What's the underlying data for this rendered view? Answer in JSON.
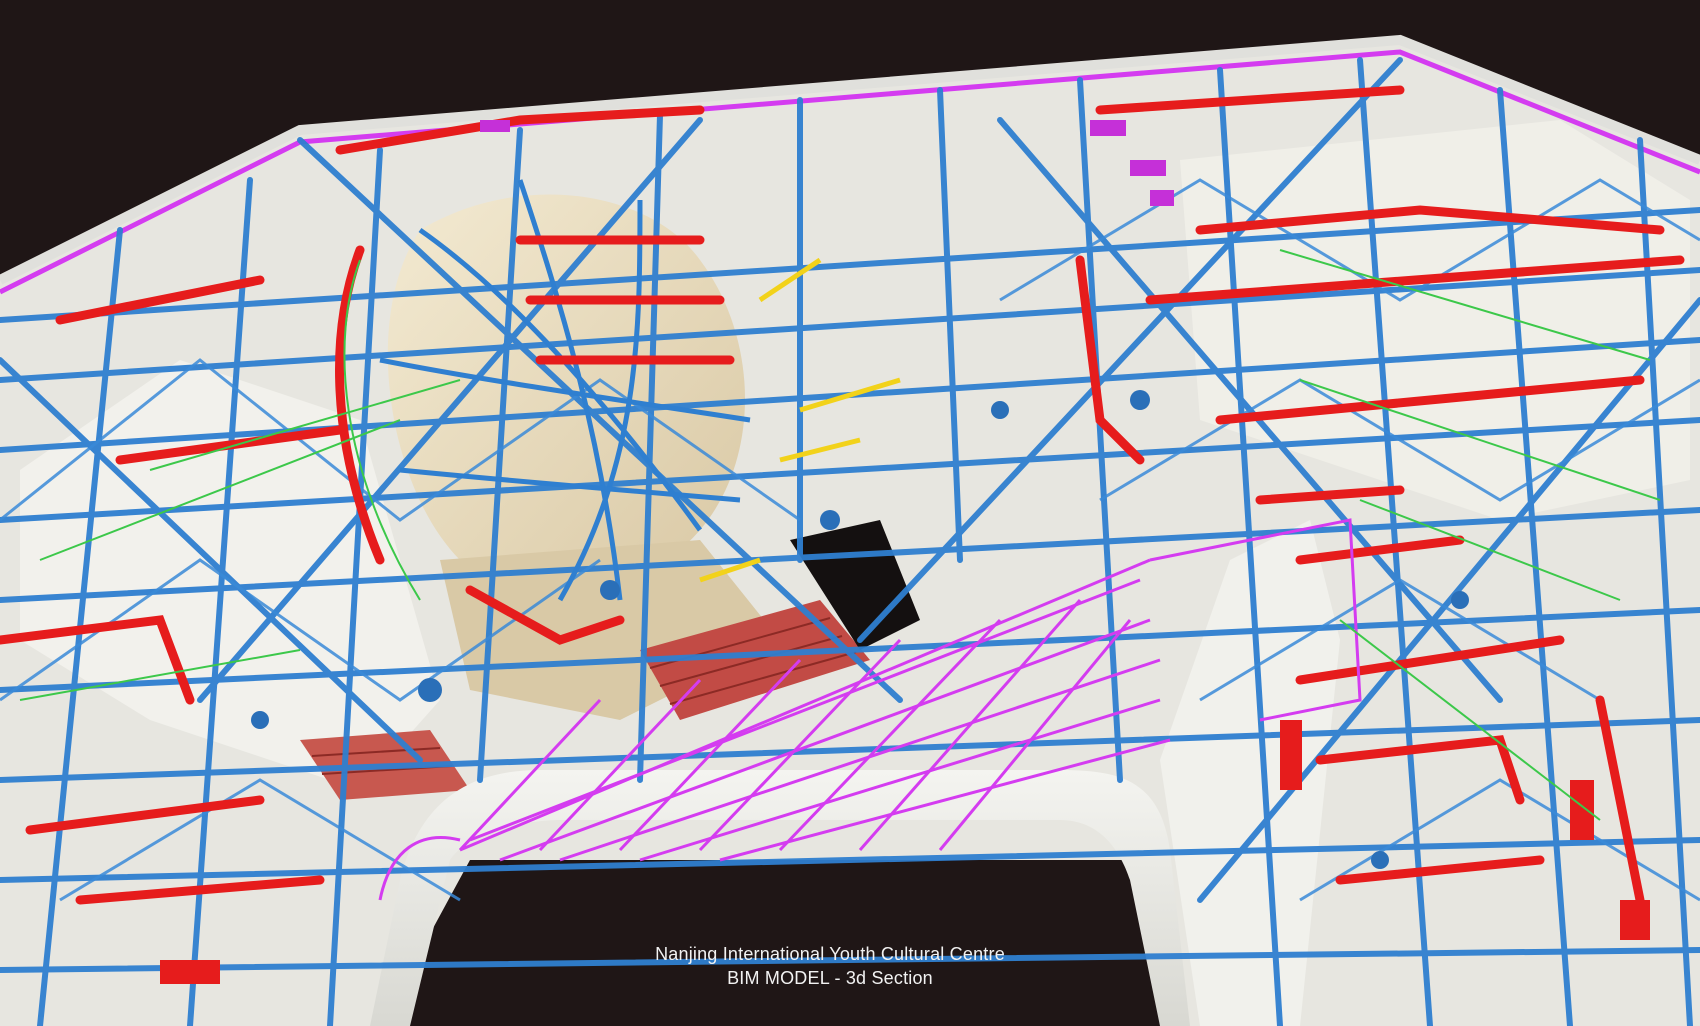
{
  "caption": {
    "line1": "Nanjing International Youth Cultural Centre",
    "line2": "BIM MODEL - 3d Section"
  },
  "palette": {
    "background": "#1f1616",
    "structure_blue": "#2f7fd0",
    "mep_red": "#e61c1c",
    "facade_magenta": "#d43cf0",
    "conduit_green": "#3cc84a",
    "accent_yellow": "#f2d21a",
    "shell_white": "#eeeeea",
    "seating_red": "#c8504a",
    "dome_beige": "#e9dcc0"
  }
}
